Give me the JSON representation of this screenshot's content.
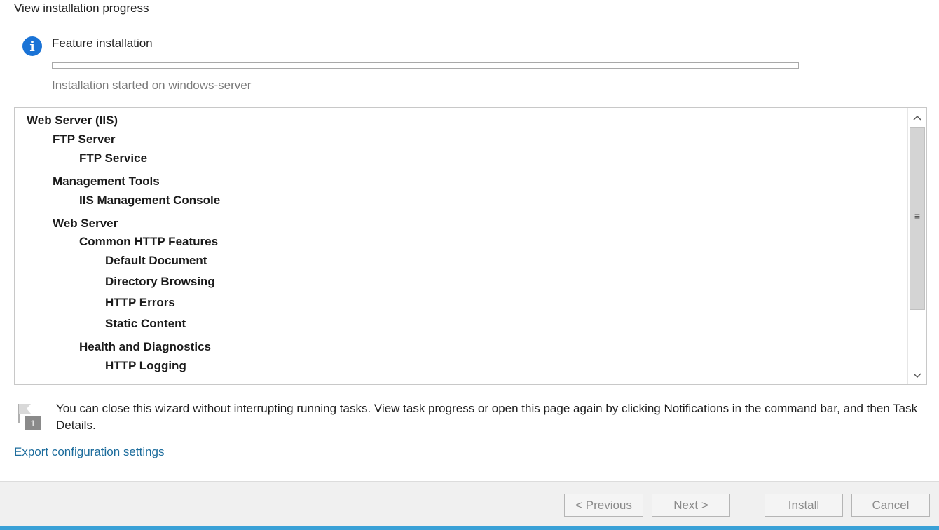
{
  "page": {
    "heading": "View installation progress"
  },
  "install": {
    "title": "Feature installation",
    "progress_percent": 0,
    "status": "Installation started on windows-server"
  },
  "features": [
    {
      "label": "Web Server (IIS)",
      "level": 0
    },
    {
      "label": "FTP Server",
      "level": 1
    },
    {
      "label": "FTP Service",
      "level": 2
    },
    {
      "label": "Management Tools",
      "level": 1
    },
    {
      "label": "IIS Management Console",
      "level": 2
    },
    {
      "label": "Web Server",
      "level": 1
    },
    {
      "label": "Common HTTP Features",
      "level": 2
    },
    {
      "label": "Default Document",
      "level": 3
    },
    {
      "label": "Directory Browsing",
      "level": 3
    },
    {
      "label": "HTTP Errors",
      "level": 3
    },
    {
      "label": "Static Content",
      "level": 3
    },
    {
      "label": "Health and Diagnostics",
      "level": 2
    },
    {
      "label": "HTTP Logging",
      "level": 3
    }
  ],
  "notice": {
    "text": "You can close this wizard without interrupting running tasks. View task progress or open this page again by clicking Notifications in the command bar, and then Task Details.",
    "badge": "1"
  },
  "export_link": "Export configuration settings",
  "buttons": {
    "previous": "< Previous",
    "next": "Next >",
    "install": "Install",
    "cancel": "Cancel"
  },
  "colors": {
    "info_icon": "#1a73d6",
    "link": "#1c6c9c",
    "taskbar": "#3aa1d7"
  }
}
